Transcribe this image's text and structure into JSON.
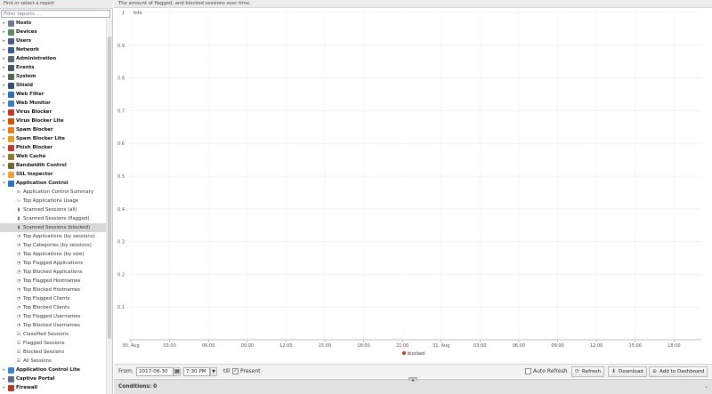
{
  "left_panel": {
    "title": "Find or select a report",
    "filter_placeholder": "Filter reports ...",
    "categories": [
      {
        "label": "Hosts",
        "icon": "hosts-icon",
        "color": "#6b7c93",
        "expanded": false
      },
      {
        "label": "Devices",
        "icon": "devices-icon",
        "color": "#5a8a5a",
        "expanded": false
      },
      {
        "label": "Users",
        "icon": "users-icon",
        "color": "#4a5d7a",
        "expanded": false
      },
      {
        "label": "Network",
        "icon": "network-icon",
        "color": "#3b5b8a",
        "expanded": false
      },
      {
        "label": "Administration",
        "icon": "administration-icon",
        "color": "#556677",
        "expanded": false
      },
      {
        "label": "Events",
        "icon": "events-icon",
        "color": "#445566",
        "expanded": false
      },
      {
        "label": "System",
        "icon": "system-icon",
        "color": "#4c6a4c",
        "expanded": false
      },
      {
        "label": "Shield",
        "icon": "shield-icon",
        "color": "#355070",
        "expanded": false
      },
      {
        "label": "Web Filter",
        "icon": "web-filter-icon",
        "color": "#2e6db4",
        "expanded": false
      },
      {
        "label": "Web Monitor",
        "icon": "web-monitor-icon",
        "color": "#3a7bc8",
        "expanded": false
      },
      {
        "label": "Virus Blocker",
        "icon": "virus-blocker-icon",
        "color": "#c0392b",
        "expanded": false
      },
      {
        "label": "Virus Blocker Lite",
        "icon": "virus-blocker-lite-icon",
        "color": "#d35400",
        "expanded": false
      },
      {
        "label": "Spam Blocker",
        "icon": "spam-blocker-icon",
        "color": "#e67e22",
        "expanded": false
      },
      {
        "label": "Spam Blocker Lite",
        "icon": "spam-blocker-lite-icon",
        "color": "#e69a22",
        "expanded": false
      },
      {
        "label": "Phish Blocker",
        "icon": "phish-blocker-icon",
        "color": "#c0392b",
        "expanded": false
      },
      {
        "label": "Web Cache",
        "icon": "web-cache-icon",
        "color": "#8e7b2e",
        "expanded": false
      },
      {
        "label": "Bandwidth Control",
        "icon": "bandwidth-control-icon",
        "color": "#6a6a2e",
        "expanded": false
      },
      {
        "label": "SSL Inspector",
        "icon": "ssl-inspector-icon",
        "color": "#e8a33c",
        "expanded": false
      },
      {
        "label": "Application Control",
        "icon": "application-control-icon",
        "color": "#2f6fc1",
        "expanded": true
      }
    ],
    "app_control_reports": [
      {
        "label": "Application Control Summary",
        "icon": "text-report-icon"
      },
      {
        "label": "Top Applications Usage",
        "icon": "line-chart-icon"
      },
      {
        "label": "Scanned Sessions (all)",
        "icon": "bar-chart-icon"
      },
      {
        "label": "Scanned Sessions (flagged)",
        "icon": "bar-chart-icon"
      },
      {
        "label": "Scanned Sessions (blocked)",
        "icon": "bar-chart-icon"
      },
      {
        "label": "Top Applications (by sessions)",
        "icon": "pie-chart-icon"
      },
      {
        "label": "Top Categories (by sessions)",
        "icon": "pie-chart-icon"
      },
      {
        "label": "Top Applications (by size)",
        "icon": "pie-chart-icon"
      },
      {
        "label": "Top Flagged Applications",
        "icon": "pie-chart-icon"
      },
      {
        "label": "Top Blocked Applications",
        "icon": "pie-chart-icon"
      },
      {
        "label": "Top Flagged Hostnames",
        "icon": "pie-chart-icon"
      },
      {
        "label": "Top Blocked Hostnames",
        "icon": "pie-chart-icon"
      },
      {
        "label": "Top Flagged Clients",
        "icon": "pie-chart-icon"
      },
      {
        "label": "Top Blocked Clients",
        "icon": "pie-chart-icon"
      },
      {
        "label": "Top Flagged Usernames",
        "icon": "pie-chart-icon"
      },
      {
        "label": "Top Blocked Usernames",
        "icon": "pie-chart-icon"
      },
      {
        "label": "Classified Sessions",
        "icon": "list-icon"
      },
      {
        "label": "Flagged Sessions",
        "icon": "list-icon"
      },
      {
        "label": "Blocked Sessions",
        "icon": "list-icon"
      },
      {
        "label": "All Sessions",
        "icon": "list-icon"
      }
    ],
    "selected_report": "Scanned Sessions (blocked)",
    "trailing_categories": [
      {
        "label": "Application Control Lite",
        "icon": "application-control-lite-icon",
        "color": "#3f7fd1",
        "expanded": false
      },
      {
        "label": "Captive Portal",
        "icon": "captive-portal-icon",
        "color": "#5a6c8a",
        "expanded": false
      },
      {
        "label": "Firewall",
        "icon": "firewall-icon",
        "color": "#b03a2e",
        "expanded": false
      }
    ]
  },
  "report": {
    "description": "The amount of flagged, and blocked sessions over time."
  },
  "chart_data": {
    "type": "line",
    "ylabel": "hits",
    "ylim": [
      0,
      1
    ],
    "y_ticks": [
      0.1,
      0.2,
      0.3,
      0.4,
      0.5,
      0.6,
      0.7,
      0.8,
      0.9,
      1
    ],
    "x_tick_labels": [
      "30. Aug",
      "03:00",
      "06:00",
      "09:00",
      "12:00",
      "15:00",
      "18:00",
      "21:00",
      "31. Aug",
      "03:00",
      "06:00",
      "09:00",
      "12:00",
      "15:00",
      "18:00"
    ],
    "series": [
      {
        "name": "blocked",
        "color": "#c0392b",
        "values": []
      }
    ],
    "grid": true,
    "legend_position": "bottom-center"
  },
  "toolbar": {
    "from_label": "From:",
    "from_date": "2017-08-30",
    "from_time": "7:30 PM",
    "till_label": "till",
    "present_label": "Present",
    "present_checked": true,
    "auto_refresh_label": "Auto Refresh",
    "auto_refresh_checked": false,
    "refresh_label": "Refresh",
    "download_label": "Download",
    "add_dashboard_label": "Add to Dashboard"
  },
  "conditions": {
    "label": "Conditions: 0"
  }
}
